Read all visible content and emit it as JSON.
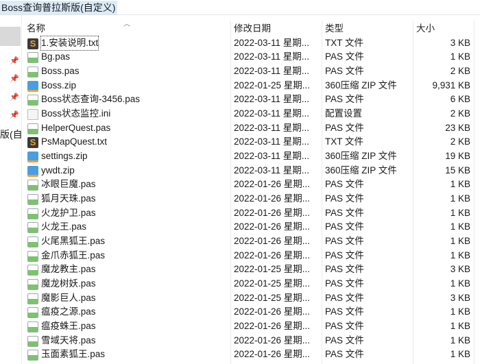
{
  "window": {
    "title": "Boss查询普拉斯版(自定义)"
  },
  "nav": {
    "partial_text": "版(自定"
  },
  "columns": {
    "name": "名称",
    "date": "修改日期",
    "type": "类型",
    "size": "大小"
  },
  "files": [
    {
      "name": "1.安装说明.txt",
      "date": "2022-03-11 星期...",
      "type": "TXT 文件",
      "size": "3 KB",
      "icon": "txt"
    },
    {
      "name": "Bg.pas",
      "date": "2022-03-11 星期...",
      "type": "PAS 文件",
      "size": "1 KB",
      "icon": "pas"
    },
    {
      "name": "Boss.pas",
      "date": "2022-03-11 星期...",
      "type": "PAS 文件",
      "size": "2 KB",
      "icon": "pas"
    },
    {
      "name": "Boss.zip",
      "date": "2022-01-25 星期...",
      "type": "360压缩 ZIP 文件",
      "size": "9,931 KB",
      "icon": "zip"
    },
    {
      "name": "Boss状态查询-3456.pas",
      "date": "2022-03-11 星期...",
      "type": "PAS 文件",
      "size": "6 KB",
      "icon": "pas"
    },
    {
      "name": "Boss状态监控.ini",
      "date": "2022-03-11 星期...",
      "type": "配置设置",
      "size": "2 KB",
      "icon": "ini"
    },
    {
      "name": "HelperQuest.pas",
      "date": "2022-03-11 星期...",
      "type": "PAS 文件",
      "size": "23 KB",
      "icon": "pas"
    },
    {
      "name": "PsMapQuest.txt",
      "date": "2022-03-11 星期...",
      "type": "TXT 文件",
      "size": "2 KB",
      "icon": "txt"
    },
    {
      "name": "settings.zip",
      "date": "2022-03-11 星期...",
      "type": "360压缩 ZIP 文件",
      "size": "19 KB",
      "icon": "zip"
    },
    {
      "name": "ywdt.zip",
      "date": "2022-03-11 星期...",
      "type": "360压缩 ZIP 文件",
      "size": "15 KB",
      "icon": "zip"
    },
    {
      "name": "冰眼巨魔.pas",
      "date": "2022-01-26 星期...",
      "type": "PAS 文件",
      "size": "1 KB",
      "icon": "pas"
    },
    {
      "name": "狐月天珠.pas",
      "date": "2022-01-26 星期...",
      "type": "PAS 文件",
      "size": "1 KB",
      "icon": "pas"
    },
    {
      "name": "火龙护卫.pas",
      "date": "2022-01-26 星期...",
      "type": "PAS 文件",
      "size": "1 KB",
      "icon": "pas"
    },
    {
      "name": "火龙王.pas",
      "date": "2022-01-26 星期...",
      "type": "PAS 文件",
      "size": "1 KB",
      "icon": "pas"
    },
    {
      "name": "火尾黑狐王.pas",
      "date": "2022-01-26 星期...",
      "type": "PAS 文件",
      "size": "1 KB",
      "icon": "pas"
    },
    {
      "name": "金爪赤狐王.pas",
      "date": "2022-01-26 星期...",
      "type": "PAS 文件",
      "size": "1 KB",
      "icon": "pas"
    },
    {
      "name": "魔龙教主.pas",
      "date": "2022-01-25 星期...",
      "type": "PAS 文件",
      "size": "3 KB",
      "icon": "pas"
    },
    {
      "name": "魔龙树妖.pas",
      "date": "2022-01-25 星期...",
      "type": "PAS 文件",
      "size": "1 KB",
      "icon": "pas"
    },
    {
      "name": "魔影巨人.pas",
      "date": "2022-01-25 星期...",
      "type": "PAS 文件",
      "size": "3 KB",
      "icon": "pas"
    },
    {
      "name": "瘟疫之源.pas",
      "date": "2022-01-26 星期...",
      "type": "PAS 文件",
      "size": "1 KB",
      "icon": "pas"
    },
    {
      "name": "瘟疫蛛王.pas",
      "date": "2022-01-26 星期...",
      "type": "PAS 文件",
      "size": "1 KB",
      "icon": "pas"
    },
    {
      "name": "雪域天将.pas",
      "date": "2022-01-26 星期...",
      "type": "PAS 文件",
      "size": "1 KB",
      "icon": "pas"
    },
    {
      "name": "玉面素狐王.pas",
      "date": "2022-01-26 星期...",
      "type": "PAS 文件",
      "size": "1 KB",
      "icon": "pas"
    }
  ]
}
